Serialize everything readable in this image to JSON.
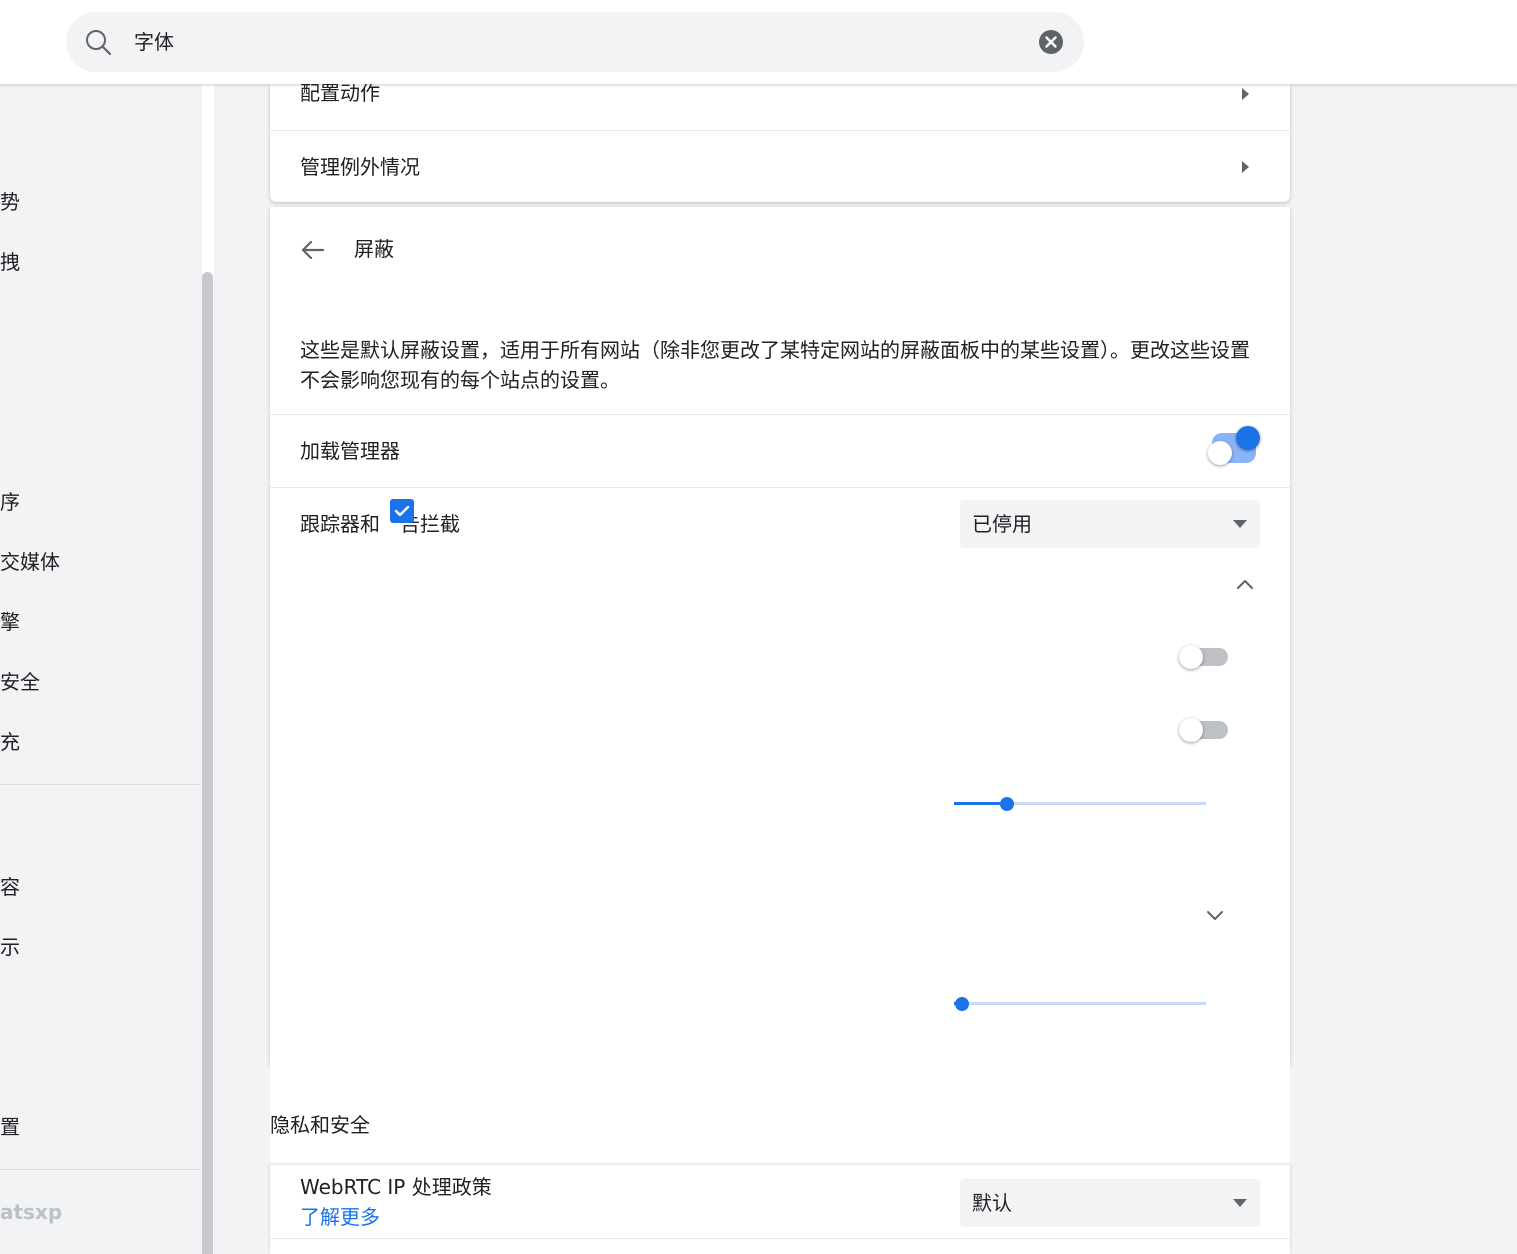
{
  "search": {
    "value": "字体"
  },
  "sidebar": {
    "items": [
      "势",
      "拽",
      "序",
      "交媒体",
      "擎",
      "安全",
      "充",
      "容",
      "示",
      "置"
    ],
    "footer": "atsxp"
  },
  "top_card": {
    "rows": [
      "配置动作",
      "管理例外情况"
    ]
  },
  "shields": {
    "title": "屏蔽",
    "description": "这些是默认屏蔽设置，适用于所有网站（除非您更改了某特定网站的屏蔽面板中的某些设置）。更改这些设置不会影响您现有的每个站点的设置。",
    "addon_manager": {
      "label": "加载管理器",
      "enabled": true
    },
    "trackers": {
      "label_part1": "跟踪器和",
      "label_part2": "告拦截",
      "selected": "已停用"
    },
    "toggle_1_enabled": false,
    "toggle_2_enabled": false,
    "slider_1_level": 0.21,
    "slider_2_level": 0.03
  },
  "privacy": {
    "heading": "隐私和安全",
    "webrtc": {
      "label": "WebRTC IP 处理政策",
      "link": "了解更多",
      "selected": "默认"
    }
  },
  "colors": {
    "accent": "#1a73e8",
    "background": "#f1f3f4"
  }
}
